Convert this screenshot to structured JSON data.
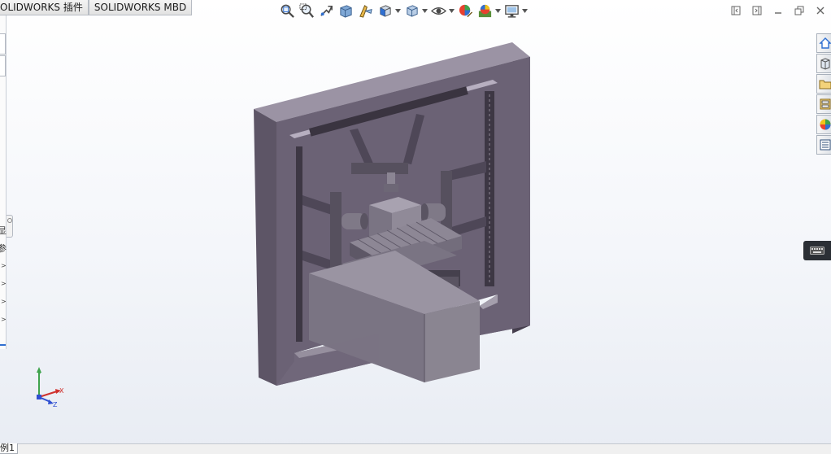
{
  "command_tabs": [
    {
      "label": "OLIDWORKS 插件"
    },
    {
      "label": "SOLIDWORKS MBD"
    }
  ],
  "view_toolbar": {
    "buttons": [
      {
        "icon": "zoom-to-fit-icon",
        "caret": false
      },
      {
        "icon": "zoom-to-area-icon",
        "caret": false
      },
      {
        "icon": "previous-view-icon",
        "caret": false
      },
      {
        "icon": "section-view-icon",
        "caret": false
      },
      {
        "icon": "dynamic-annotation-icon",
        "caret": false
      },
      {
        "icon": "view-orientation-icon",
        "caret": true
      },
      {
        "icon": "display-style-icon",
        "caret": true
      },
      {
        "icon": "hide-show-items-icon",
        "caret": true
      },
      {
        "icon": "edit-appearance-icon",
        "caret": false
      },
      {
        "icon": "apply-scene-icon",
        "caret": true
      },
      {
        "icon": "view-settings-icon",
        "caret": true
      }
    ]
  },
  "window_controls": [
    "restore-left-icon",
    "restore-right-icon",
    "minimize-icon",
    "restore-icon",
    "close-icon"
  ],
  "task_pane": [
    "solidworks-resources-icon",
    "design-library-icon",
    "file-explorer-icon",
    "view-palette-icon",
    "appearances-scenes-icon",
    "custom-properties-icon"
  ],
  "feature_manager": {
    "glyphs": [
      "显",
      "参"
    ],
    "arrows": [
      ">",
      ">",
      ">",
      ">"
    ]
  },
  "triad": {
    "x_label": "X",
    "y_label": "Y",
    "z_label": "Z"
  },
  "config_tab": {
    "label": "例1"
  },
  "colors": {
    "frame": "#5d5566",
    "frame_light": "#9b93a4",
    "frame_dark": "#463f4e",
    "base_gray": "#8a8591",
    "background_top": "#ffffff",
    "background_bottom": "#e8ecf3",
    "accent_blue": "#2f6fd1"
  }
}
